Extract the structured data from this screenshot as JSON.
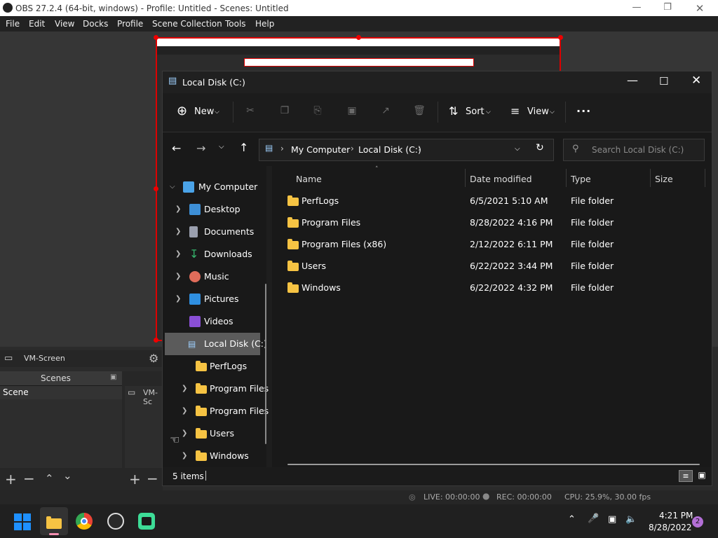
{
  "obs": {
    "title": "OBS 27.2.4 (64-bit, windows) - Profile: Untitled - Scenes: Untitled",
    "menu": [
      "File",
      "Edit",
      "View",
      "Docks",
      "Profile",
      "Scene Collection",
      "Tools",
      "Help"
    ],
    "source_label": "VM-Screen",
    "scenes_header": "Scenes",
    "scene_item": "Scene",
    "sources_item": "VM-Sc",
    "status": {
      "live": "LIVE: 00:00:00",
      "rec": "REC: 00:00:00",
      "cpu": "CPU: 25.9%, 30.00 fps"
    }
  },
  "explorer": {
    "title": "Local Disk (C:)",
    "toolbar": {
      "new": "New",
      "sort": "Sort",
      "view": "View",
      "more": "..."
    },
    "address": {
      "root": "My Computer",
      "current": "Local Disk (C:)",
      "search_placeholder": "Search Local Disk (C:)"
    },
    "nav": [
      {
        "label": "My Computer",
        "icon": "pc-icon"
      },
      {
        "label": "Desktop",
        "icon": "desktop-icon"
      },
      {
        "label": "Documents",
        "icon": "documents-icon"
      },
      {
        "label": "Downloads",
        "icon": "downloads-icon"
      },
      {
        "label": "Music",
        "icon": "music-icon"
      },
      {
        "label": "Pictures",
        "icon": "pictures-icon"
      },
      {
        "label": "Videos",
        "icon": "videos-icon"
      },
      {
        "label": "Local Disk (C:)",
        "icon": "drive-icon"
      },
      {
        "label": "PerfLogs",
        "icon": "folder-icon"
      },
      {
        "label": "Program Files",
        "icon": "folder-icon"
      },
      {
        "label": "Program Files",
        "icon": "folder-icon"
      },
      {
        "label": "Users",
        "icon": "folder-icon"
      },
      {
        "label": "Windows",
        "icon": "folder-icon"
      }
    ],
    "columns": [
      "Name",
      "Date modified",
      "Type",
      "Size"
    ],
    "files": [
      {
        "name": "PerfLogs",
        "date": "6/5/2021 5:10 AM",
        "type": "File folder"
      },
      {
        "name": "Program Files",
        "date": "8/28/2022 4:16 PM",
        "type": "File folder"
      },
      {
        "name": "Program Files (x86)",
        "date": "2/12/2022 6:11 PM",
        "type": "File folder"
      },
      {
        "name": "Users",
        "date": "6/22/2022 3:44 PM",
        "type": "File folder"
      },
      {
        "name": "Windows",
        "date": "6/22/2022 4:32 PM",
        "type": "File folder"
      }
    ],
    "status_text": "5 items"
  },
  "taskbar": {
    "time": "4:21 PM",
    "date": "8/28/2022",
    "notif_count": "2"
  },
  "colors": {
    "accent": "#0078d4",
    "obs_selection": "#dd0000",
    "folder": "#f6c343"
  }
}
